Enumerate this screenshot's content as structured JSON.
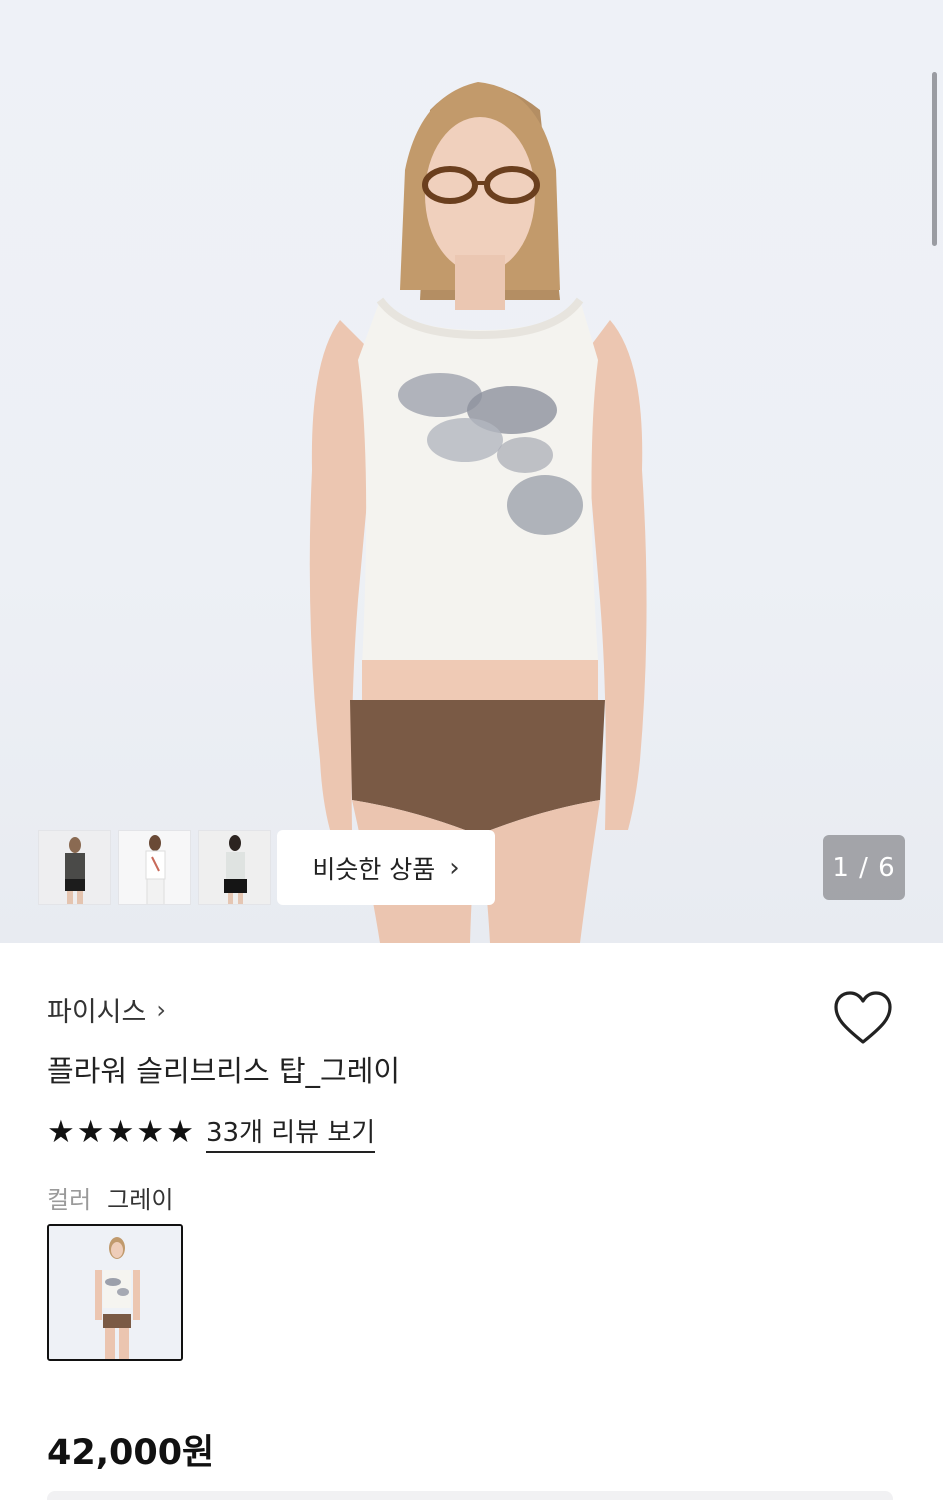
{
  "gallery": {
    "similar_label": "비슷한 상품",
    "similar_chevron": "›",
    "counter": "1 / 6",
    "thumbnails": [
      "black-tank-thumbnail",
      "white-print-tank-thumbnail",
      "white-tank-black-skirt-thumbnail"
    ]
  },
  "product": {
    "brand": "파이시스",
    "brand_arrow": "›",
    "name": "플라워 슬리브리스 탑_그레이",
    "rating_stars": 5,
    "review_link": "33개 리뷰 보기",
    "color_label": "컬러",
    "color_value": "그레이",
    "price": "42,000원"
  },
  "icons": {
    "heart": "heart-outline-icon",
    "star": "star-icon",
    "chevron": "chevron-right-icon"
  },
  "colors": {
    "background": "#ffffff",
    "text": "#111111",
    "muted": "#9a9a9a",
    "counter_bg": "#7e7e82"
  }
}
